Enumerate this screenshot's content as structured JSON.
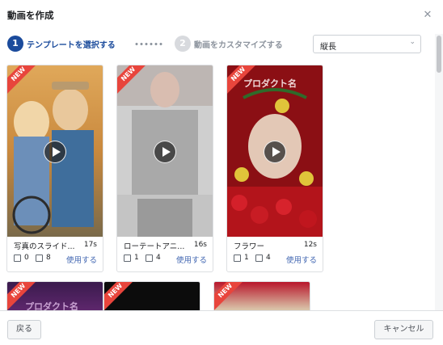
{
  "dialog": {
    "title": "動画を作成",
    "close_glyph": "✕"
  },
  "steps": [
    {
      "number": "1",
      "label": "テンプレートを選択する"
    },
    {
      "number": "2",
      "label": "動画をカスタマイズする"
    }
  ],
  "orientation_select": {
    "value": "縦長",
    "chevron": "⌄"
  },
  "badge_text": "NEW",
  "templates": [
    {
      "name": "写真のスライド...",
      "duration": "17s",
      "text_count": "0",
      "image_count": "8",
      "use_label": "使用する"
    },
    {
      "name": "ローテートアニ...",
      "duration": "16s",
      "text_count": "1",
      "image_count": "4",
      "use_label": "使用する"
    },
    {
      "name": "フラワー",
      "duration": "12s",
      "text_count": "1",
      "image_count": "4",
      "use_label": "使用する",
      "overlay_text": "プロダクト名"
    }
  ],
  "row2_overlay_text": "プロダクト名",
  "footer": {
    "back_label": "戻る",
    "cancel_label": "キャンセル"
  }
}
